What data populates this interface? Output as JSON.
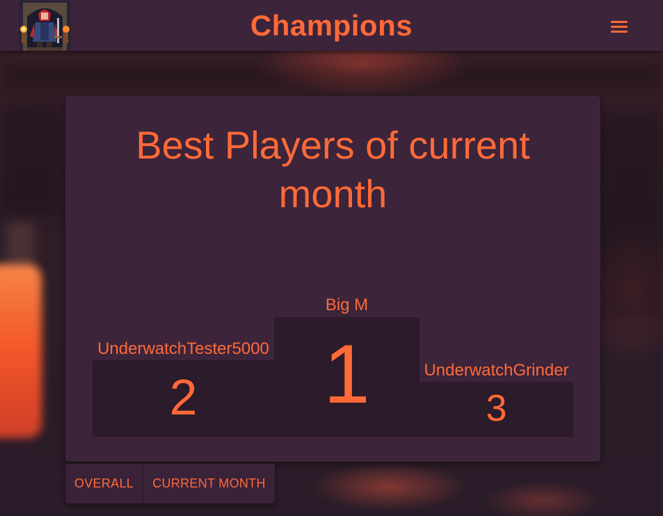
{
  "header": {
    "title": "Champions",
    "logo_icon": "hero-knight-logo-icon",
    "menu_icon": "hamburger-menu-icon"
  },
  "card": {
    "title": "Best Players of current month"
  },
  "podium": {
    "first": {
      "rank": "1",
      "name": "Big M"
    },
    "second": {
      "rank": "2",
      "name": "UnderwatchTester5000"
    },
    "third": {
      "rank": "3",
      "name": "UnderwatchGrinder"
    }
  },
  "tabs": [
    {
      "label": "OVERALL"
    },
    {
      "label": "CURRENT MONTH"
    }
  ],
  "colors": {
    "accent": "#ff6a38",
    "header_bg": "#3c243b",
    "card_bg": "#3c243a",
    "podium_bg": "#2c1b2a"
  }
}
